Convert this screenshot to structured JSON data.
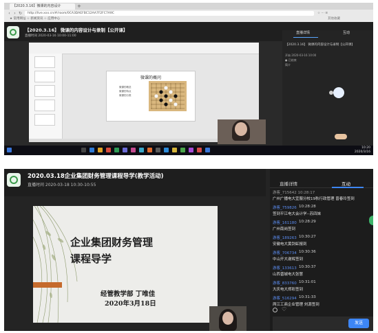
{
  "top": {
    "tab_label": "【2020.3.16】微课的内容设计",
    "tab_new": "+",
    "address": "http://live.xxx.cn/#/room/0CA3DAEFBC12AA7F2FC7A9C",
    "bookmarks": "★ 常用网址  ☆ 新闻资讯  ☆ 应用中心",
    "bookmark_right": "其他收藏",
    "title": "【2020.3.16】 微课的内容设计与录制【公开课】",
    "time": "直播时间 2020-03-16 10:00-11:00",
    "slide_title": "微课的概问",
    "slide_bullets": [
      "微课的概念",
      "微课的特点",
      "微课的分类"
    ],
    "panel_tab1": "直播详情",
    "panel_tab2": "互动",
    "panel_title": "【2020.3.16】 微课的内容设计与录制【公开课】",
    "panel_lines": [
      "开始 2020-03-16 10:00",
      "● 已结束",
      "简介"
    ],
    "clock_time": "10:20",
    "clock_date": "2020/3/16"
  },
  "bottom": {
    "title": "2020.03.18企业集团财务管理课程导学(教学活动)",
    "time": "直播时间 2020-03-18 10:30-10:55",
    "slide_title_1": "企业集团财务管理",
    "slide_title_2": "课程导学",
    "slide_sub_1": "经管教学部 丁唯佳",
    "slide_sub_2": "2020年3月18日",
    "tab_detail": "直播详情",
    "tab_interact": "互动",
    "first_line": "游客_715642 10:28:17",
    "messages": [
      {
        "user": "游客_759826",
        "time": "10:28:28",
        "text": "签到平江电大会计学--苏四妹"
      },
      {
        "user": "游客_161180",
        "time": "10:28:29",
        "text": "广州南岗签到"
      },
      {
        "user": "游客_189263",
        "time": "10:30:27",
        "text": "安徽电大黄剑虹报到"
      },
      {
        "user": "游客_706734",
        "time": "10:30:36",
        "text": "中山开大谢辉签到"
      },
      {
        "user": "游客_133613",
        "time": "10:30:37",
        "text": "山西晋城电大张慧"
      },
      {
        "user": "游客_833760",
        "time": "10:31:01",
        "text": "大庆电大郑彩签到"
      },
      {
        "user": "游客_516294",
        "time": "10:31:33",
        "text": "两江工商企业管理 刘源签到"
      }
    ],
    "top_msg": "广州广播电大宜服分校19秋行政管理 曾春玲签到",
    "send_label": "发送"
  }
}
